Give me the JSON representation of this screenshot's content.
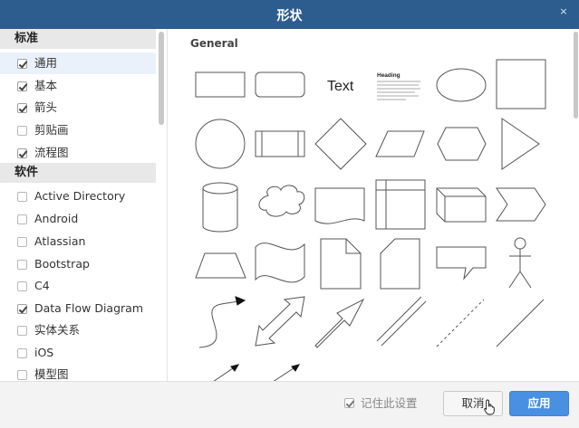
{
  "dialog": {
    "title": "形状",
    "close_icon": "×"
  },
  "sidebar": {
    "sections": [
      {
        "header": "标准",
        "items": [
          {
            "label": "通用",
            "checked": true,
            "selected": true
          },
          {
            "label": "基本",
            "checked": true
          },
          {
            "label": "箭头",
            "checked": true
          },
          {
            "label": "剪贴画",
            "checked": false
          },
          {
            "label": "流程图",
            "checked": true
          }
        ]
      },
      {
        "header": "软件",
        "items": [
          {
            "label": "Active Directory",
            "checked": false
          },
          {
            "label": "Android",
            "checked": false
          },
          {
            "label": "Atlassian",
            "checked": false
          },
          {
            "label": "Bootstrap",
            "checked": false
          },
          {
            "label": "C4",
            "checked": false
          },
          {
            "label": "Data Flow Diagram",
            "checked": true
          },
          {
            "label": "实体关系",
            "checked": false
          },
          {
            "label": "iOS",
            "checked": false
          },
          {
            "label": "模型图",
            "checked": false
          }
        ]
      }
    ]
  },
  "preview": {
    "group_title": "General",
    "text_shape": "Text",
    "heading_shape": "Heading"
  },
  "footer": {
    "remember_label": "记住此设置",
    "remember_checked": true,
    "cancel_label": "取消",
    "apply_label": "应用"
  },
  "colors": {
    "titlebar": "#2d5c8f",
    "apply": "#4a90e2",
    "stroke": "#555555"
  }
}
